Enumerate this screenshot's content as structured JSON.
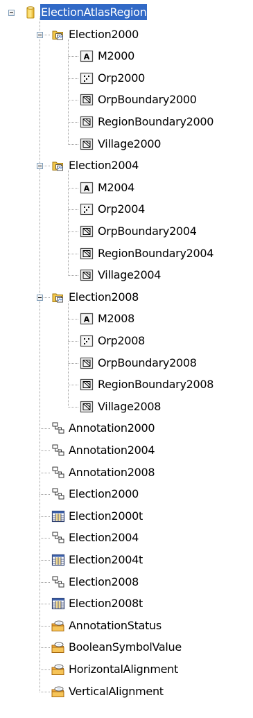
{
  "root": {
    "label": "ElectionAtlasRegion",
    "icon": "database-icon",
    "selected": true
  },
  "items": [
    {
      "label": "Election2000",
      "type": "feature-dataset",
      "icon": "feature-dataset-icon",
      "expanded": true,
      "children": [
        {
          "label": "M2000",
          "type": "annotation-class",
          "icon": "annotation-class-icon"
        },
        {
          "label": "Orp2000",
          "type": "point-feature-class",
          "icon": "point-feature-class-icon"
        },
        {
          "label": "OrpBoundary2000",
          "type": "polygon-feature-class",
          "icon": "polygon-feature-class-icon"
        },
        {
          "label": "RegionBoundary2000",
          "type": "polygon-feature-class",
          "icon": "polygon-feature-class-icon"
        },
        {
          "label": "Village2000",
          "type": "polygon-feature-class",
          "icon": "polygon-feature-class-icon"
        }
      ]
    },
    {
      "label": "Election2004",
      "type": "feature-dataset",
      "icon": "feature-dataset-icon",
      "expanded": true,
      "children": [
        {
          "label": "M2004",
          "type": "annotation-class",
          "icon": "annotation-class-icon"
        },
        {
          "label": "Orp2004",
          "type": "point-feature-class",
          "icon": "point-feature-class-icon"
        },
        {
          "label": "OrpBoundary2004",
          "type": "polygon-feature-class",
          "icon": "polygon-feature-class-icon"
        },
        {
          "label": "RegionBoundary2004",
          "type": "polygon-feature-class",
          "icon": "polygon-feature-class-icon"
        },
        {
          "label": "Village2004",
          "type": "polygon-feature-class",
          "icon": "polygon-feature-class-icon"
        }
      ]
    },
    {
      "label": "Election2008",
      "type": "feature-dataset",
      "icon": "feature-dataset-icon",
      "expanded": true,
      "children": [
        {
          "label": "M2008",
          "type": "annotation-class",
          "icon": "annotation-class-icon"
        },
        {
          "label": "Orp2008",
          "type": "point-feature-class",
          "icon": "point-feature-class-icon"
        },
        {
          "label": "OrpBoundary2008",
          "type": "polygon-feature-class",
          "icon": "polygon-feature-class-icon"
        },
        {
          "label": "RegionBoundary2008",
          "type": "polygon-feature-class",
          "icon": "polygon-feature-class-icon"
        },
        {
          "label": "Village2008",
          "type": "polygon-feature-class",
          "icon": "polygon-feature-class-icon"
        }
      ]
    },
    {
      "label": "Annotation2000",
      "type": "relationship-class",
      "icon": "relationship-class-icon"
    },
    {
      "label": "Annotation2004",
      "type": "relationship-class",
      "icon": "relationship-class-icon"
    },
    {
      "label": "Annotation2008",
      "type": "relationship-class",
      "icon": "relationship-class-icon"
    },
    {
      "label": "Election2000",
      "type": "relationship-class",
      "icon": "relationship-class-icon"
    },
    {
      "label": "Election2000t",
      "type": "table",
      "icon": "table-icon"
    },
    {
      "label": "Election2004",
      "type": "relationship-class",
      "icon": "relationship-class-icon"
    },
    {
      "label": "Election2004t",
      "type": "table",
      "icon": "table-icon"
    },
    {
      "label": "Election2008",
      "type": "relationship-class",
      "icon": "relationship-class-icon"
    },
    {
      "label": "Election2008t",
      "type": "table",
      "icon": "table-icon"
    },
    {
      "label": "AnnotationStatus",
      "type": "domain",
      "icon": "domain-icon"
    },
    {
      "label": "BooleanSymbolValue",
      "type": "domain",
      "icon": "domain-icon"
    },
    {
      "label": "HorizontalAlignment",
      "type": "domain",
      "icon": "domain-icon"
    },
    {
      "label": "VerticalAlignment",
      "type": "domain",
      "icon": "domain-icon"
    }
  ],
  "colors": {
    "selection_bg": "#3169c6",
    "selection_text": "#ffffff",
    "tree_line": "#a0a0a0",
    "folder_yellow": "#f4c84a",
    "database_yellow": "#f2c12e",
    "icon_frame": "#4a4a4a"
  }
}
